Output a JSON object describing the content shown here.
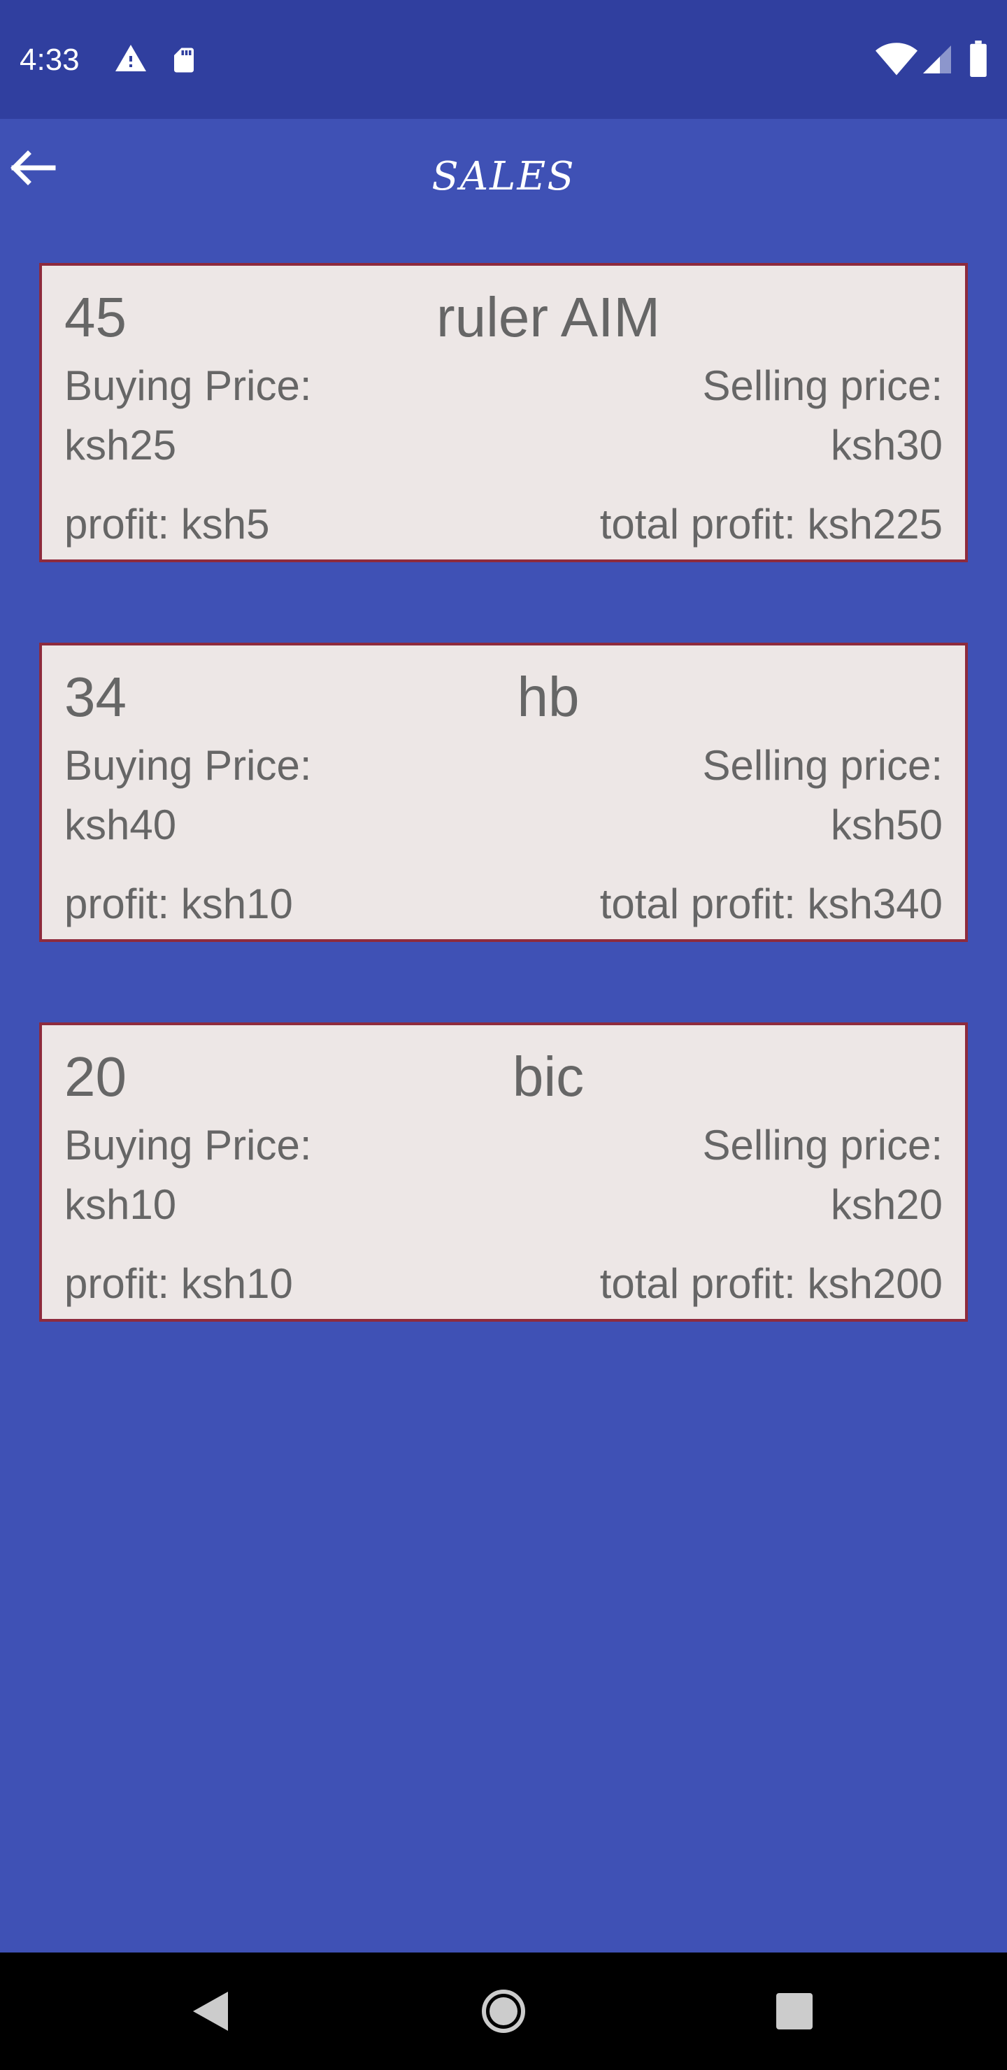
{
  "status_bar": {
    "time": "4:33",
    "icons": [
      "warning-icon",
      "sd-card-icon",
      "wifi-icon",
      "signal-icon",
      "battery-icon"
    ]
  },
  "app_bar": {
    "title": "SALES",
    "back_icon": "back-arrow-icon"
  },
  "sales": [
    {
      "quantity": "45",
      "name": "ruler AIM",
      "buying_label": "Buying Price:",
      "buying_value": "ksh25",
      "selling_label": "Selling price:",
      "selling_value": "ksh30",
      "profit": "profit: ksh5",
      "total_profit": "total profit: ksh225"
    },
    {
      "quantity": "34",
      "name": "hb",
      "buying_label": "Buying Price:",
      "buying_value": "ksh40",
      "selling_label": "Selling price:",
      "selling_value": "ksh50",
      "profit": "profit: ksh10",
      "total_profit": "total profit: ksh340"
    },
    {
      "quantity": "20",
      "name": "bic",
      "buying_label": "Buying Price:",
      "buying_value": "ksh10",
      "selling_label": "Selling price:",
      "selling_value": "ksh20",
      "profit": "profit: ksh10",
      "total_profit": "total profit: ksh200"
    }
  ],
  "nav_bar": {
    "icons": [
      "nav-back-icon",
      "nav-home-icon",
      "nav-recents-icon"
    ]
  },
  "colors": {
    "primary": "#3f51b5",
    "primary_dark": "#303f9f",
    "card_background": "#ede7e6",
    "card_border": "#8e2b3d",
    "card_text": "#666666"
  }
}
